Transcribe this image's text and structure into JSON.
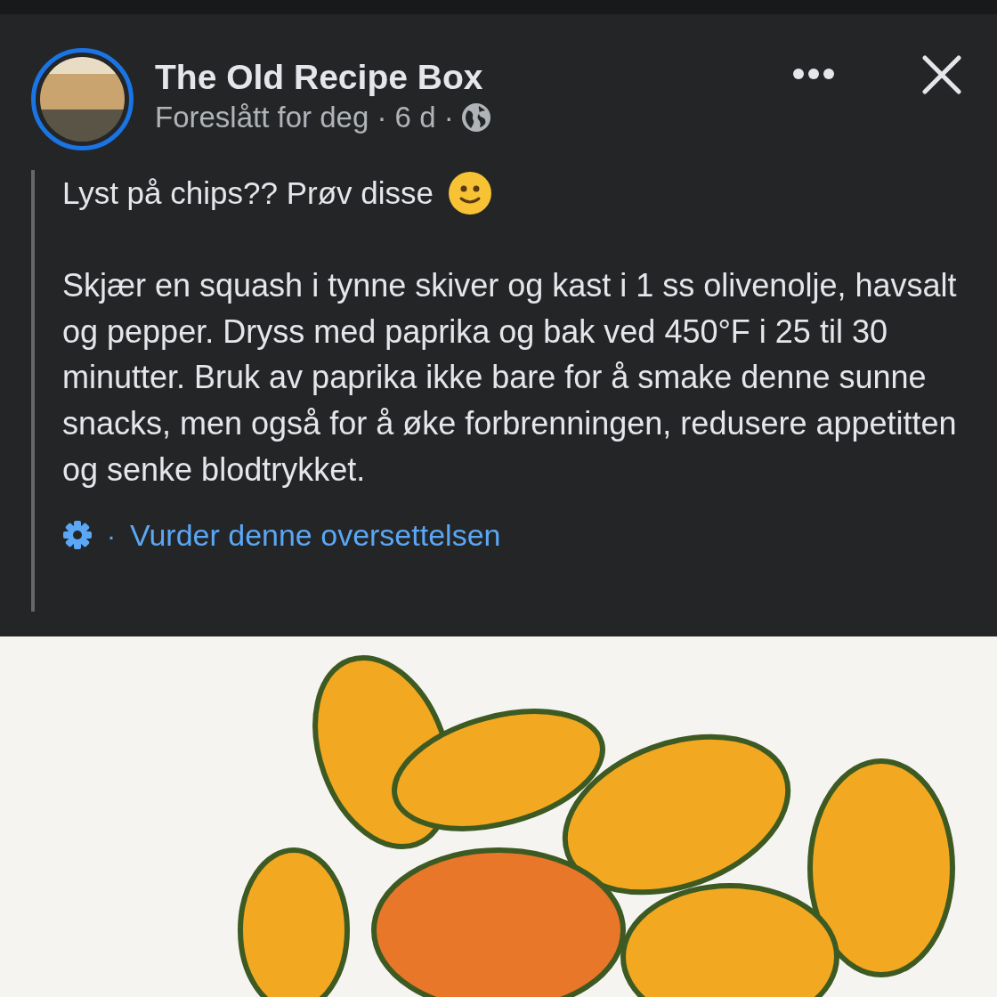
{
  "post": {
    "author": "The Old Recipe Box",
    "meta": "Foreslått for deg · 6 d ·",
    "headline": "Lyst på chips?? Prøv disse",
    "body": "Skjær en squash i tynne skiver og kast i 1 ss olivenolje, havsalt og pepper. Dryss med paprika og bak ved 450°F i 25 til 30 minutter. Bruk av paprika ikke bare for å smake denne sunne snacks, men også for å øke forbrenningen, redusere appetitten og senke blodtrykket.",
    "translation_separator": "·",
    "translation_link": "Vurder denne oversettelsen"
  }
}
